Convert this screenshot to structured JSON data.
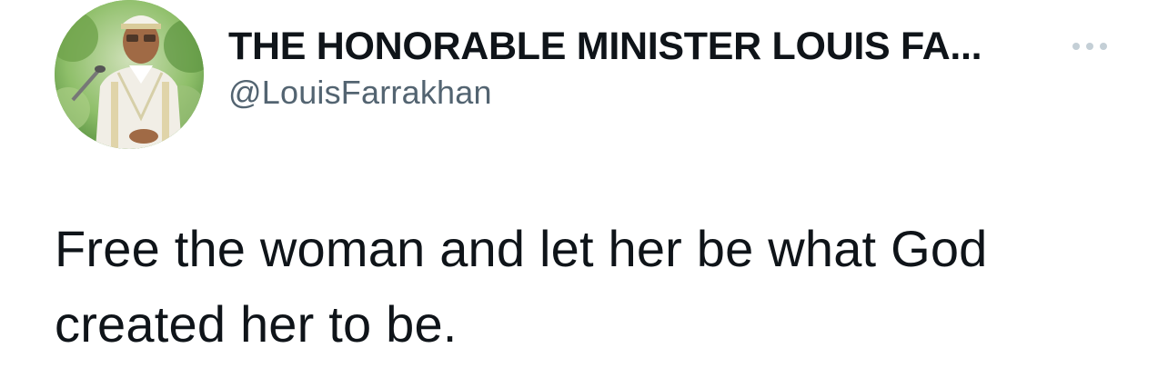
{
  "tweet": {
    "author": {
      "display_name": "THE HONORABLE MINISTER LOUIS FA...",
      "handle": "@LouisFarrakhan",
      "avatar": "profile-photo"
    },
    "more_icon": "more-horizontal-icon",
    "text": "Free the woman and let her be what God created her to be."
  },
  "colors": {
    "primary_text": "#0f1419",
    "secondary_text": "#536471",
    "icon": "#c4cfd6",
    "background": "#ffffff"
  }
}
